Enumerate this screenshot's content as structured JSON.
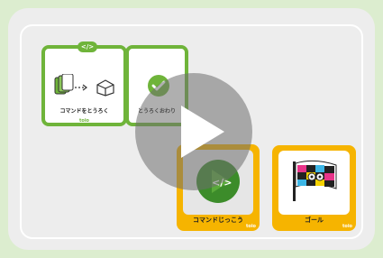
{
  "cards": {
    "program_tag": "</>",
    "command_label": "コマンドをとうろく",
    "register_done_label": "とうろくおわり",
    "run_label": "コマンドじっこう",
    "goal_label": "ゴール",
    "brand": "toio"
  },
  "icons": {
    "stack": "card-stack-icon",
    "arrow": "dotted-arrow-icon",
    "cube": "cube-icon",
    "check": "check-circle-icon",
    "run": "code-run-icon",
    "goal": "goal-flag-icon",
    "play": "play-icon"
  },
  "colors": {
    "green": "#6fb43a",
    "yellow": "#f6b400",
    "panel": "#ededed",
    "background": "#dcedcf"
  }
}
